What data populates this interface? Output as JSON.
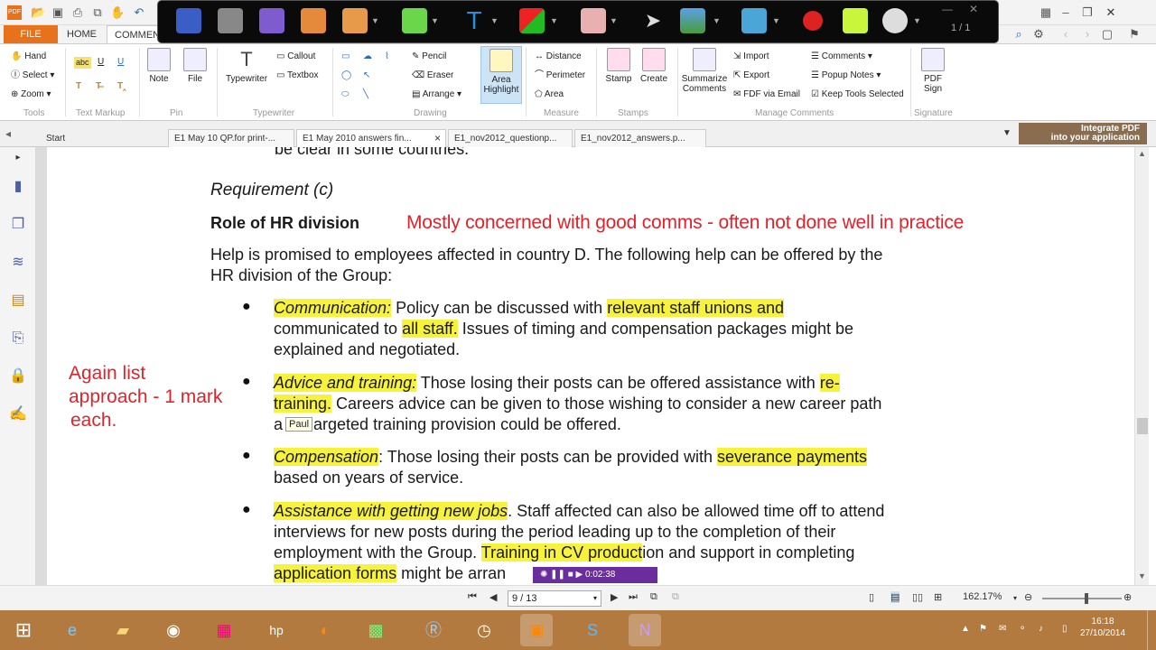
{
  "app": {
    "file_tab": "FILE",
    "home_tab": "HOME",
    "comment_tab": "COMMENT",
    "page_counter": "1 / 1"
  },
  "ribbon": {
    "tools": {
      "hand": "Hand",
      "select": "Select",
      "zoom": "Zoom",
      "group": "Tools"
    },
    "markup": {
      "group": "Text Markup",
      "abc": "abc",
      "u1": "U",
      "u2": "U"
    },
    "pin": {
      "note": "Note",
      "file": "File",
      "group": "Pin"
    },
    "typewriter": {
      "typewriter": "Typewriter",
      "callout": "Callout",
      "textbox": "Textbox",
      "group": "Typewriter"
    },
    "drawing": {
      "pencil": "Pencil",
      "eraser": "Eraser",
      "arrange": "Arrange",
      "group": "Drawing"
    },
    "area": {
      "l1": "Area",
      "l2": "Highlight"
    },
    "measure": {
      "distance": "Distance",
      "perimeter": "Perimeter",
      "area": "Area",
      "group": "Measure"
    },
    "stamps": {
      "stamp": "Stamp",
      "create": "Create",
      "group": "Stamps"
    },
    "manage": {
      "summ1": "Summarize",
      "summ2": "Comments",
      "import": "Import",
      "export": "Export",
      "fdf": "FDF via Email",
      "comments": "Comments",
      "popup": "Popup Notes",
      "keep": "Keep Tools Selected",
      "group": "Manage Comments"
    },
    "sign": {
      "l1": "PDF",
      "l2": "Sign",
      "group": "Signature"
    }
  },
  "doctabs": [
    "Start",
    "E1 May 10 QP.for print-...",
    "E1 May 2010 answers fin...",
    "E1_nov2012_questionp...",
    "E1_nov2012_answers.p..."
  ],
  "ad": {
    "l1": "Integrate PDF",
    "l2": "into your application"
  },
  "doc": {
    "top_line": "be clear in some countries.",
    "requirement": "Requirement (c)",
    "heading": "Role of HR division",
    "annotation_top": "Mostly concerned with good comms - often not done well in practice",
    "intro1": "Help is promised to employees affected in country D. The following help can be offered by the",
    "intro2": "HR division of the Group:",
    "b1": {
      "t1": "Communication:",
      "t2": " Policy can be discussed with ",
      "t3": "relevant staff unions and",
      "t4": "communicated to ",
      "t5": "all staff.",
      "t6": " Issues of timing and compensation packages might be",
      "t7": "explained and negotiated."
    },
    "b2": {
      "t1": "Advice and training:",
      "t2": " Those losing their posts can be offered assistance with ",
      "t3": "re-",
      "t4": "training.",
      "t5": " Careers advice can be given to those wishing to consider a new career path",
      "t6": "a",
      "t7": "argeted training provision could be offered."
    },
    "b3": {
      "t1": "Compensation",
      "t2": ": Those losing their posts can be provided with ",
      "t3": "severance payments",
      "t4": "based on years of service."
    },
    "b4": {
      "t1": "Assistance with getting new jobs",
      "t2": ". Staff affected can also be allowed time off to attend",
      "t3": "interviews for new posts during the period leading up to the completion of their",
      "t4": "employment with the Group. ",
      "t5": "Training in CV product",
      "t6": "ion and support in completing",
      "t7": "application forms",
      "t8": " might be arran"
    },
    "side_note": [
      "Again list",
      "approach - 1 mark",
      "each."
    ],
    "tooltip": "Paul"
  },
  "recorder": {
    "time": "0:02:38"
  },
  "status": {
    "page": "9 / 13",
    "zoom": "162.17%"
  },
  "clock": {
    "time": "16:18",
    "date": "27/10/2014"
  },
  "colors": {
    "accent": "#e8711c",
    "highlight": "#f7f23c",
    "annotation": "#e0232a",
    "taskbar": "#b37a3f"
  }
}
